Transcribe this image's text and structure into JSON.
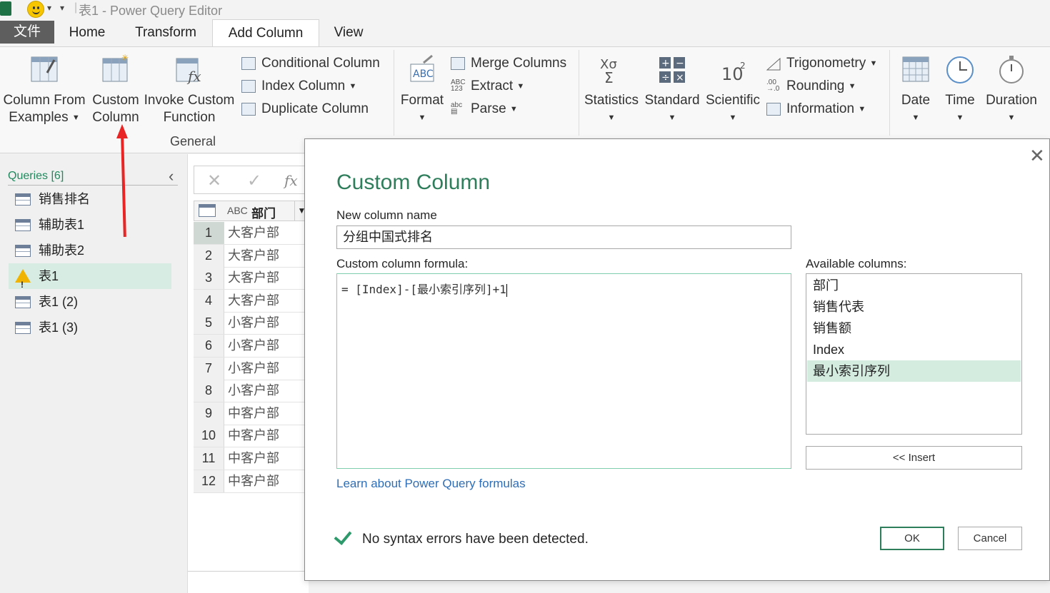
{
  "window": {
    "title": "表1 - Power Query Editor"
  },
  "tabs": [
    {
      "label": "文件"
    },
    {
      "label": "Home"
    },
    {
      "label": "Transform"
    },
    {
      "label": "Add Column"
    },
    {
      "label": "View"
    }
  ],
  "ribbon": {
    "general": {
      "column_from_examples_1": "Column From",
      "column_from_examples_2": "Examples",
      "custom_column_1": "Custom",
      "custom_column_2": "Column",
      "invoke_custom_1": "Invoke Custom",
      "invoke_custom_2": "Function",
      "conditional_column": "Conditional Column",
      "index_column": "Index Column",
      "duplicate_column": "Duplicate Column",
      "group_label": "General"
    },
    "text": {
      "format": "Format",
      "merge_columns": "Merge Columns",
      "extract": "Extract",
      "parse": "Parse"
    },
    "number": {
      "statistics": "Statistics",
      "standard": "Standard",
      "scientific": "Scientific",
      "trigonometry": "Trigonometry",
      "rounding": "Rounding",
      "information": "Information"
    },
    "datetime": {
      "date": "Date",
      "time": "Time",
      "duration": "Duration"
    }
  },
  "queries": {
    "header": "Queries [6]",
    "items": [
      {
        "label": "销售排名",
        "icon": "table-icon"
      },
      {
        "label": "辅助表1",
        "icon": "table-icon"
      },
      {
        "label": "辅助表2",
        "icon": "table-icon"
      },
      {
        "label": "表1",
        "icon": "warning-icon",
        "selected": true
      },
      {
        "label": "表1 (2)",
        "icon": "table-icon"
      },
      {
        "label": "表1 (3)",
        "icon": "table-icon"
      }
    ]
  },
  "grid": {
    "column_header": "部门",
    "column_type": "ABC",
    "rows": [
      {
        "n": "1",
        "v": "大客户部"
      },
      {
        "n": "2",
        "v": "大客户部"
      },
      {
        "n": "3",
        "v": "大客户部"
      },
      {
        "n": "4",
        "v": "大客户部"
      },
      {
        "n": "5",
        "v": "小客户部"
      },
      {
        "n": "6",
        "v": "小客户部"
      },
      {
        "n": "7",
        "v": "小客户部"
      },
      {
        "n": "8",
        "v": "小客户部"
      },
      {
        "n": "9",
        "v": "中客户部"
      },
      {
        "n": "10",
        "v": "中客户部"
      },
      {
        "n": "11",
        "v": "中客户部"
      },
      {
        "n": "12",
        "v": "中客户部"
      }
    ]
  },
  "dialog": {
    "title": "Custom Column",
    "name_label": "New column name",
    "name_value": "分组中国式排名",
    "formula_label": "Custom column formula:",
    "formula_value": "= [Index]-[最小索引序列]+1",
    "available_label": "Available columns:",
    "available_columns": [
      "部门",
      "销售代表",
      "销售额",
      "Index",
      "最小索引序列"
    ],
    "insert_button": "<< Insert",
    "learn_link": "Learn about Power Query formulas",
    "status": "No syntax errors have been detected.",
    "ok_button": "OK",
    "cancel_button": "Cancel"
  },
  "colors": {
    "accent": "#2e7d5b",
    "annotation": "#e82424",
    "link": "#2f6eb5"
  }
}
